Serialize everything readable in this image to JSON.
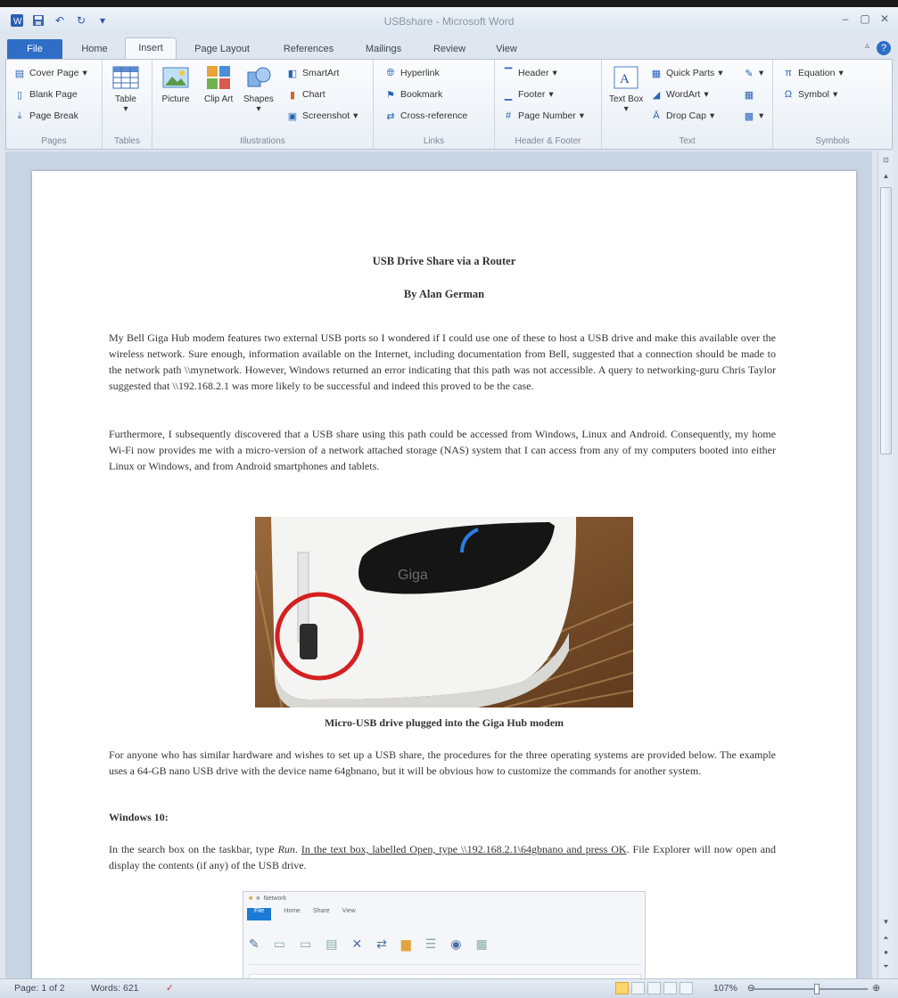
{
  "window": {
    "title": "USBshare - Microsoft Word",
    "qat": [
      "save-icon",
      "undo-icon",
      "redo-icon"
    ]
  },
  "tabs": [
    "File",
    "Home",
    "Insert",
    "Page Layout",
    "References",
    "Mailings",
    "Review",
    "View"
  ],
  "active_tab": "Insert",
  "ribbon": {
    "pages": {
      "label": "Pages",
      "items": [
        "Cover Page",
        "Blank Page",
        "Page Break"
      ]
    },
    "tables": {
      "label": "Tables",
      "button": "Table"
    },
    "illustrations": {
      "label": "Illustrations",
      "buttons": [
        "Picture",
        "Clip Art",
        "Shapes"
      ],
      "items": [
        "SmartArt",
        "Chart",
        "Screenshot"
      ]
    },
    "links": {
      "label": "Links",
      "items": [
        "Hyperlink",
        "Bookmark",
        "Cross-reference"
      ]
    },
    "header_footer": {
      "label": "Header & Footer",
      "items": [
        "Header",
        "Footer",
        "Page Number"
      ]
    },
    "text": {
      "label": "Text",
      "button": "Text Box",
      "items": [
        "Quick Parts",
        "WordArt",
        "Drop Cap"
      ]
    },
    "symbols": {
      "label": "Symbols",
      "items": [
        "Equation",
        "Symbol"
      ]
    }
  },
  "document": {
    "title": "USB Drive Share via a Router",
    "author": "By Alan German",
    "paragraphs": [
      "My Bell Giga Hub modem features two external USB ports so I wondered if I could use one of these to host a USB drive and make this available over the wireless network. Sure enough, information available on the Internet, including documentation from Bell, suggested that a connection should be made to the network path \\\\mynetwork. However, Windows returned an error indicating that this path was not accessible. A query to networking-guru Chris Taylor suggested that \\\\192.168.2.1 was more likely to be successful and indeed this proved to be the case.",
      "Furthermore, I subsequently discovered that a USB share using this path could be accessed from Windows, Linux and Android. Consequently, my home Wi-Fi now provides me with a micro-version of a network attached storage (NAS) system that I can access from any of my computers booted into either Linux or Windows, and from Android smartphones and tablets.",
      "For anyone who has similar hardware and wishes to set up a USB share, the procedures for the three operating systems are provided below. The example uses a 64-GB nano USB drive with the device name 64gbnano, but it will be obvious how to customize the commands for another system."
    ],
    "caption": "Micro-USB drive plugged into the Giga Hub modem",
    "heading": "Windows 10:",
    "win10_text_1": "In the search box on the taskbar, type ",
    "win10_run": "Run",
    "win10_text_2": ". ",
    "win10_underlined": "In the text box, labelled Open, type \\\\192.168.2.1\\64gbnano and press OK",
    "win10_text_3": ". File Explorer will now open and display the contents (if any) of the USB drive.",
    "photo_brand": "Giga",
    "screenshot_labels": [
      "File",
      "Home",
      "Share",
      "View",
      "Network"
    ]
  },
  "status": {
    "page": "Page: 1 of 2",
    "words": "Words: 621",
    "zoom": "107%",
    "zoom_level": 0.56
  }
}
